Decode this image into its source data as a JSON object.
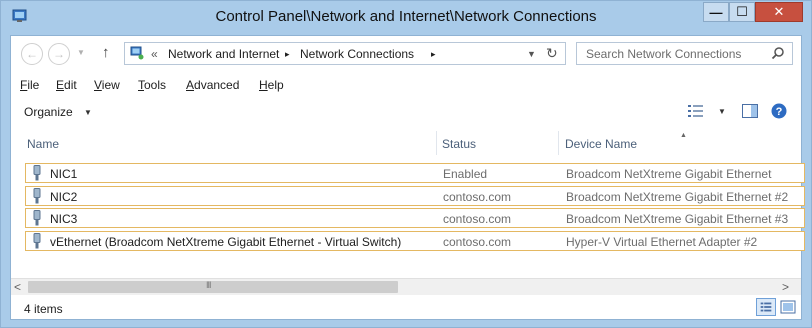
{
  "window": {
    "title": "Control Panel\\Network and Internet\\Network Connections",
    "minimize_glyph": "—",
    "maximize_glyph": "☐",
    "close_glyph": "✕"
  },
  "nav": {
    "back_glyph": "←",
    "forward_glyph": "→",
    "recent_glyph": "▼",
    "up_glyph": "↑"
  },
  "address": {
    "overflow_glyph": "«",
    "crumbs": [
      "Network and Internet",
      "Network Connections"
    ],
    "separator_glyph": "▸",
    "dropdown_glyph": "▼",
    "refresh_glyph": "↻"
  },
  "search": {
    "placeholder": "Search Network Connections"
  },
  "menu": {
    "items": [
      "File",
      "Edit",
      "View",
      "Tools",
      "Advanced",
      "Help"
    ]
  },
  "command_bar": {
    "organize_label": "Organize",
    "caret_glyph": "▼"
  },
  "columns": {
    "name": "Name",
    "status": "Status",
    "device": "Device Name",
    "sort_glyph": "▲"
  },
  "rows": [
    {
      "name": "NIC1",
      "status": "Enabled",
      "device": "Broadcom NetXtreme Gigabit Ethernet"
    },
    {
      "name": "NIC2",
      "status": "contoso.com",
      "device": "Broadcom NetXtreme Gigabit Ethernet #2"
    },
    {
      "name": "NIC3",
      "status": "contoso.com",
      "device": "Broadcom NetXtreme Gigabit Ethernet #3"
    },
    {
      "name": "vEthernet (Broadcom NetXtreme Gigabit Ethernet - Virtual Switch)",
      "status": "contoso.com",
      "device": "Hyper-V Virtual Ethernet Adapter #2"
    }
  ],
  "scrollbar": {
    "left_glyph": "<",
    "right_glyph": ">",
    "grip_glyph": "III"
  },
  "statusbar": {
    "item_count": "4 items"
  },
  "colors": {
    "frame": "#a9cbe9",
    "row_border": "#e4b862",
    "header_text": "#4c607a",
    "muted_text": "#6d6d6d",
    "close_button": "#c7503f"
  }
}
